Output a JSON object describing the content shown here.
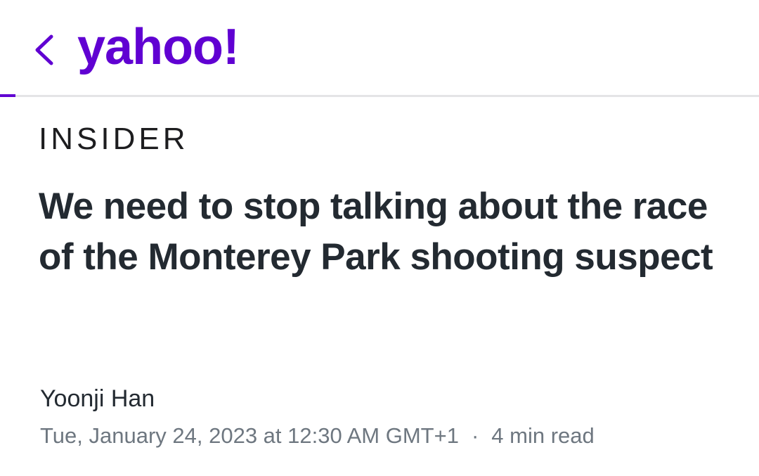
{
  "header": {
    "logo_text": "yahoo!",
    "back_icon": "chevron-left-icon",
    "accent_color": "#6001d2"
  },
  "article": {
    "publisher": "INSIDER",
    "title": "We need to stop talking about the race of the Monterey Park shooting suspect",
    "author": "Yoonji Han",
    "date": "Tue, January 24, 2023 at 12:30 AM GMT+1",
    "separator": "·",
    "read_time": "4 min read"
  }
}
